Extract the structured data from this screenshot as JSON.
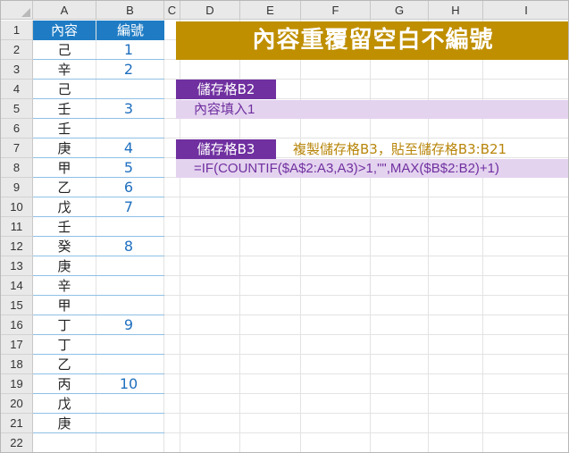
{
  "columns": [
    "A",
    "B",
    "C",
    "D",
    "E",
    "F",
    "G",
    "H",
    "I"
  ],
  "rows": [
    "1",
    "2",
    "3",
    "4",
    "5",
    "6",
    "7",
    "8",
    "9",
    "10",
    "11",
    "12",
    "13",
    "14",
    "15",
    "16",
    "17",
    "18",
    "19",
    "20",
    "21",
    "22"
  ],
  "header": {
    "content": "內容",
    "number": "編號"
  },
  "data_rows": [
    {
      "content": "己",
      "number": "1"
    },
    {
      "content": "辛",
      "number": "2"
    },
    {
      "content": "己",
      "number": ""
    },
    {
      "content": "壬",
      "number": "3"
    },
    {
      "content": "壬",
      "number": ""
    },
    {
      "content": "庚",
      "number": "4"
    },
    {
      "content": "甲",
      "number": "5"
    },
    {
      "content": "乙",
      "number": "6"
    },
    {
      "content": "戊",
      "number": "7"
    },
    {
      "content": "壬",
      "number": ""
    },
    {
      "content": "癸",
      "number": "8"
    },
    {
      "content": "庚",
      "number": ""
    },
    {
      "content": "辛",
      "number": ""
    },
    {
      "content": "甲",
      "number": ""
    },
    {
      "content": "丁",
      "number": "9"
    },
    {
      "content": "丁",
      "number": ""
    },
    {
      "content": "乙",
      "number": ""
    },
    {
      "content": "丙",
      "number": "10"
    },
    {
      "content": "戊",
      "number": ""
    },
    {
      "content": "庚",
      "number": ""
    }
  ],
  "title": "內容重覆留空白不編號",
  "b2_label": "儲存格B2",
  "b2_formula": "內容填入1",
  "b3_label": "儲存格B3",
  "b3_note": "複製儲存格B3，貼至儲存格B3:B21",
  "b3_formula": "=IF(COUNTIF($A$2:A3,A3)>1,\"\",MAX($B$2:B2)+1)",
  "colors": {
    "header_blue": "#1f7cc4",
    "title_gold": "#bf8f00",
    "tag_purple": "#7030a0",
    "band_lilac": "#e4d3ef",
    "number_blue": "#1f6fbf",
    "note_gold": "#b8860b"
  }
}
